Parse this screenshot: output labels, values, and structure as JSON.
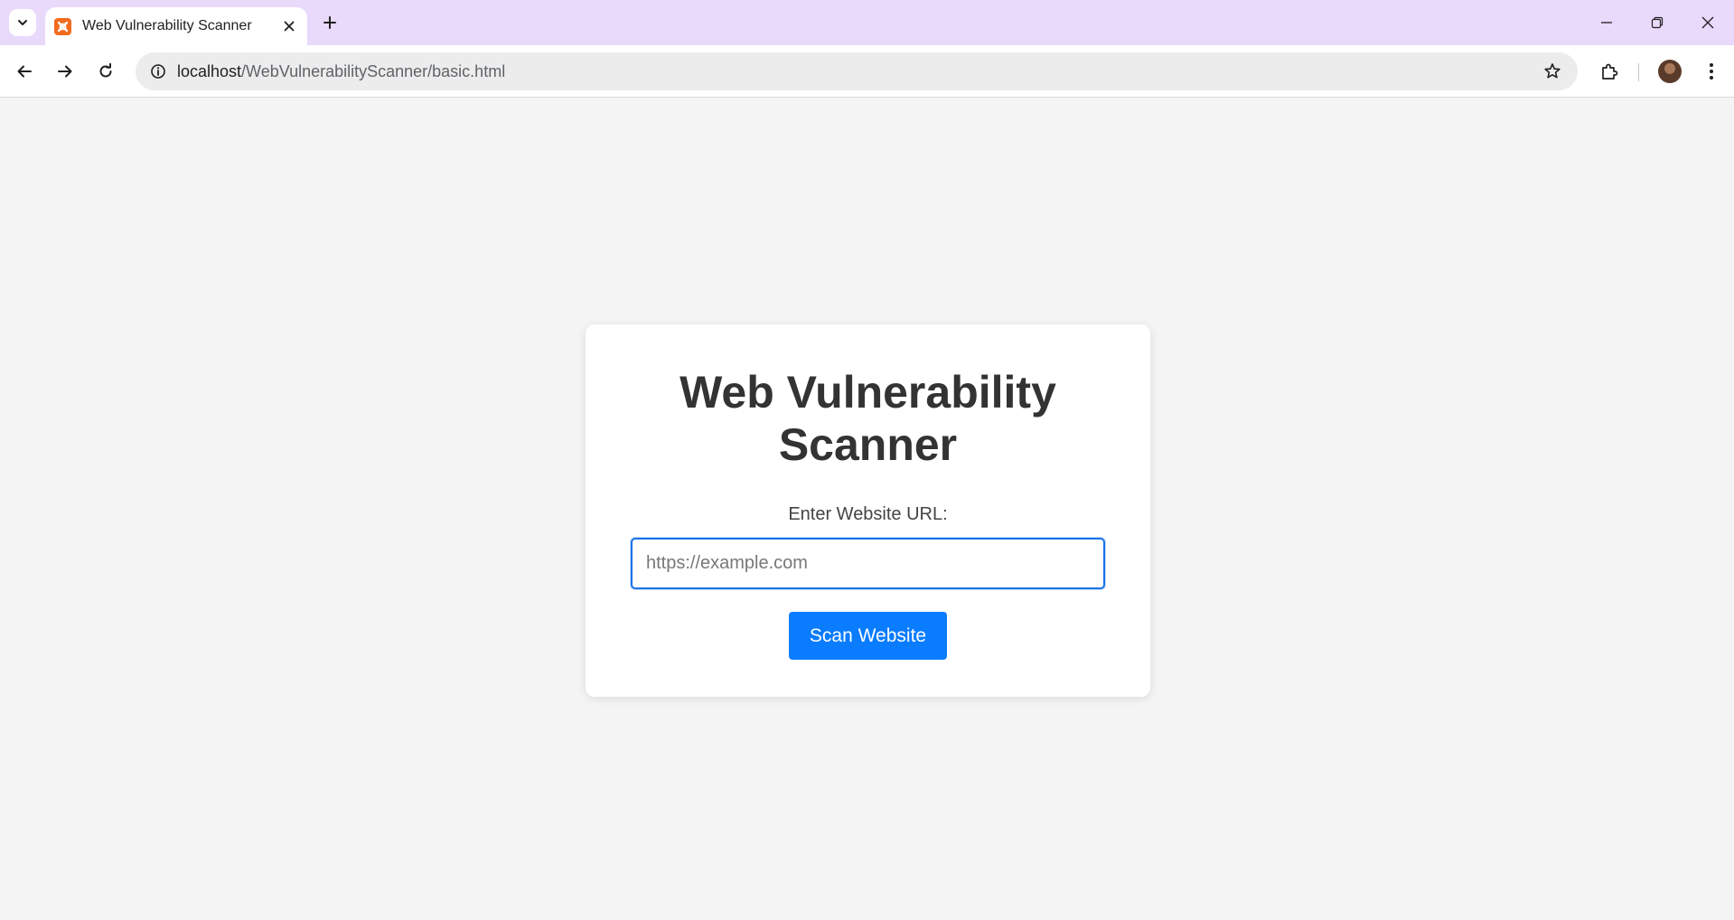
{
  "browser": {
    "tab": {
      "title": "Web Vulnerability Scanner",
      "favicon": "xampp-icon"
    },
    "address_bar": {
      "host": "localhost",
      "path": "/WebVulnerabilityScanner/basic.html"
    },
    "accent": "#e9d9fb"
  },
  "page": {
    "title": "Web Vulnerability Scanner",
    "url_label": "Enter Website URL:",
    "url_input": {
      "value": "",
      "placeholder": "https://example.com"
    },
    "scan_button": "Scan Website",
    "colors": {
      "button": "#0a7cff",
      "input_focus": "#1a73e8",
      "background": "#f4f4f4"
    }
  }
}
